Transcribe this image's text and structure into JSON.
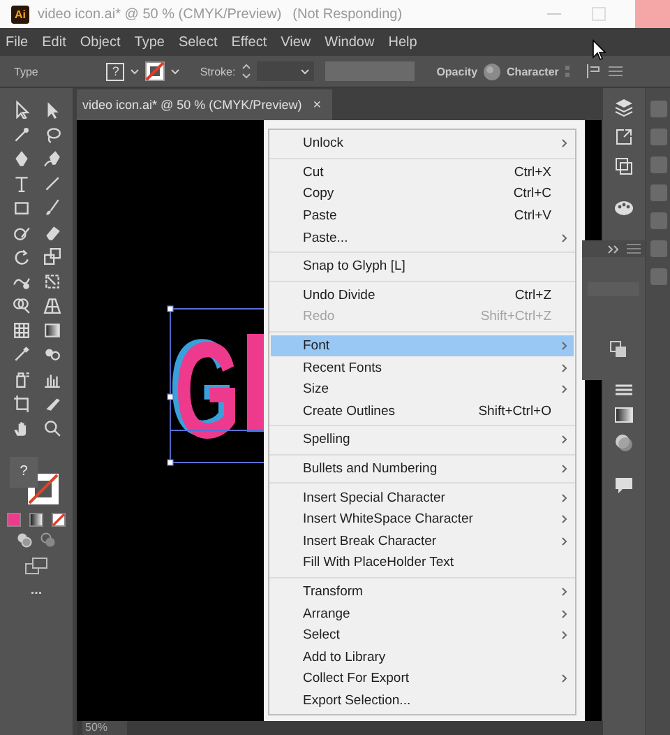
{
  "window": {
    "logo": "Ai",
    "title": "video icon.ai* @ 50 % (CMYK/Preview)",
    "status": "(Not Responding)"
  },
  "menu_bar": [
    "File",
    "Edit",
    "Object",
    "Type",
    "Select",
    "Effect",
    "View",
    "Window",
    "Help"
  ],
  "control_bar": {
    "mode": "Type",
    "fill_swatch": "?",
    "stroke_label": "Stroke:",
    "opacity": "Opacity",
    "character": "Character"
  },
  "document_tab": {
    "title": "video icon.ai* @ 50 % (CMYK/Preview)",
    "close": "×"
  },
  "toolbar": {
    "fill_swatch": "?",
    "more": "..."
  },
  "canvas": {
    "artwork_text": "G"
  },
  "context_menu": {
    "groups": [
      [
        {
          "label": "Unlock",
          "submenu": true,
          "disabled": false,
          "selected": false
        }
      ],
      [
        {
          "label": "Cut",
          "shortcut": "Ctrl+X",
          "submenu": false,
          "disabled": false,
          "selected": false
        },
        {
          "label": "Copy",
          "shortcut": "Ctrl+C",
          "submenu": false,
          "disabled": false,
          "selected": false
        },
        {
          "label": "Paste",
          "shortcut": "Ctrl+V",
          "submenu": false,
          "disabled": false,
          "selected": false
        },
        {
          "label": "Paste...",
          "submenu": true,
          "disabled": false,
          "selected": false
        }
      ],
      [
        {
          "label": "Snap to Glyph [L]",
          "submenu": false,
          "disabled": false,
          "selected": false
        }
      ],
      [
        {
          "label": "Undo Divide",
          "shortcut": "Ctrl+Z",
          "submenu": false,
          "disabled": false,
          "selected": false
        },
        {
          "label": "Redo",
          "shortcut": "Shift+Ctrl+Z",
          "submenu": false,
          "disabled": true,
          "selected": false
        }
      ],
      [
        {
          "label": "Font",
          "submenu": true,
          "disabled": false,
          "selected": true
        },
        {
          "label": "Recent Fonts",
          "submenu": true,
          "disabled": false,
          "selected": false
        },
        {
          "label": "Size",
          "submenu": true,
          "disabled": false,
          "selected": false
        },
        {
          "label": "Create Outlines",
          "shortcut": "Shift+Ctrl+O",
          "submenu": false,
          "disabled": false,
          "selected": false
        }
      ],
      [
        {
          "label": "Spelling",
          "submenu": true,
          "disabled": false,
          "selected": false
        }
      ],
      [
        {
          "label": "Bullets and Numbering",
          "submenu": true,
          "disabled": false,
          "selected": false
        }
      ],
      [
        {
          "label": "Insert Special Character",
          "submenu": true,
          "disabled": false,
          "selected": false
        },
        {
          "label": "Insert WhiteSpace Character",
          "submenu": true,
          "disabled": false,
          "selected": false
        },
        {
          "label": "Insert Break Character",
          "submenu": true,
          "disabled": false,
          "selected": false
        },
        {
          "label": "Fill With PlaceHolder Text",
          "submenu": false,
          "disabled": false,
          "selected": false
        }
      ],
      [
        {
          "label": "Transform",
          "submenu": true,
          "disabled": false,
          "selected": false
        },
        {
          "label": "Arrange",
          "submenu": true,
          "disabled": false,
          "selected": false
        },
        {
          "label": "Select",
          "submenu": true,
          "disabled": false,
          "selected": false
        },
        {
          "label": "Add to Library",
          "submenu": false,
          "disabled": false,
          "selected": false
        },
        {
          "label": "Collect For Export",
          "submenu": true,
          "disabled": false,
          "selected": false
        },
        {
          "label": "Export Selection...",
          "submenu": false,
          "disabled": false,
          "selected": false
        }
      ]
    ]
  },
  "status_bar": {
    "zoom": "50%"
  }
}
